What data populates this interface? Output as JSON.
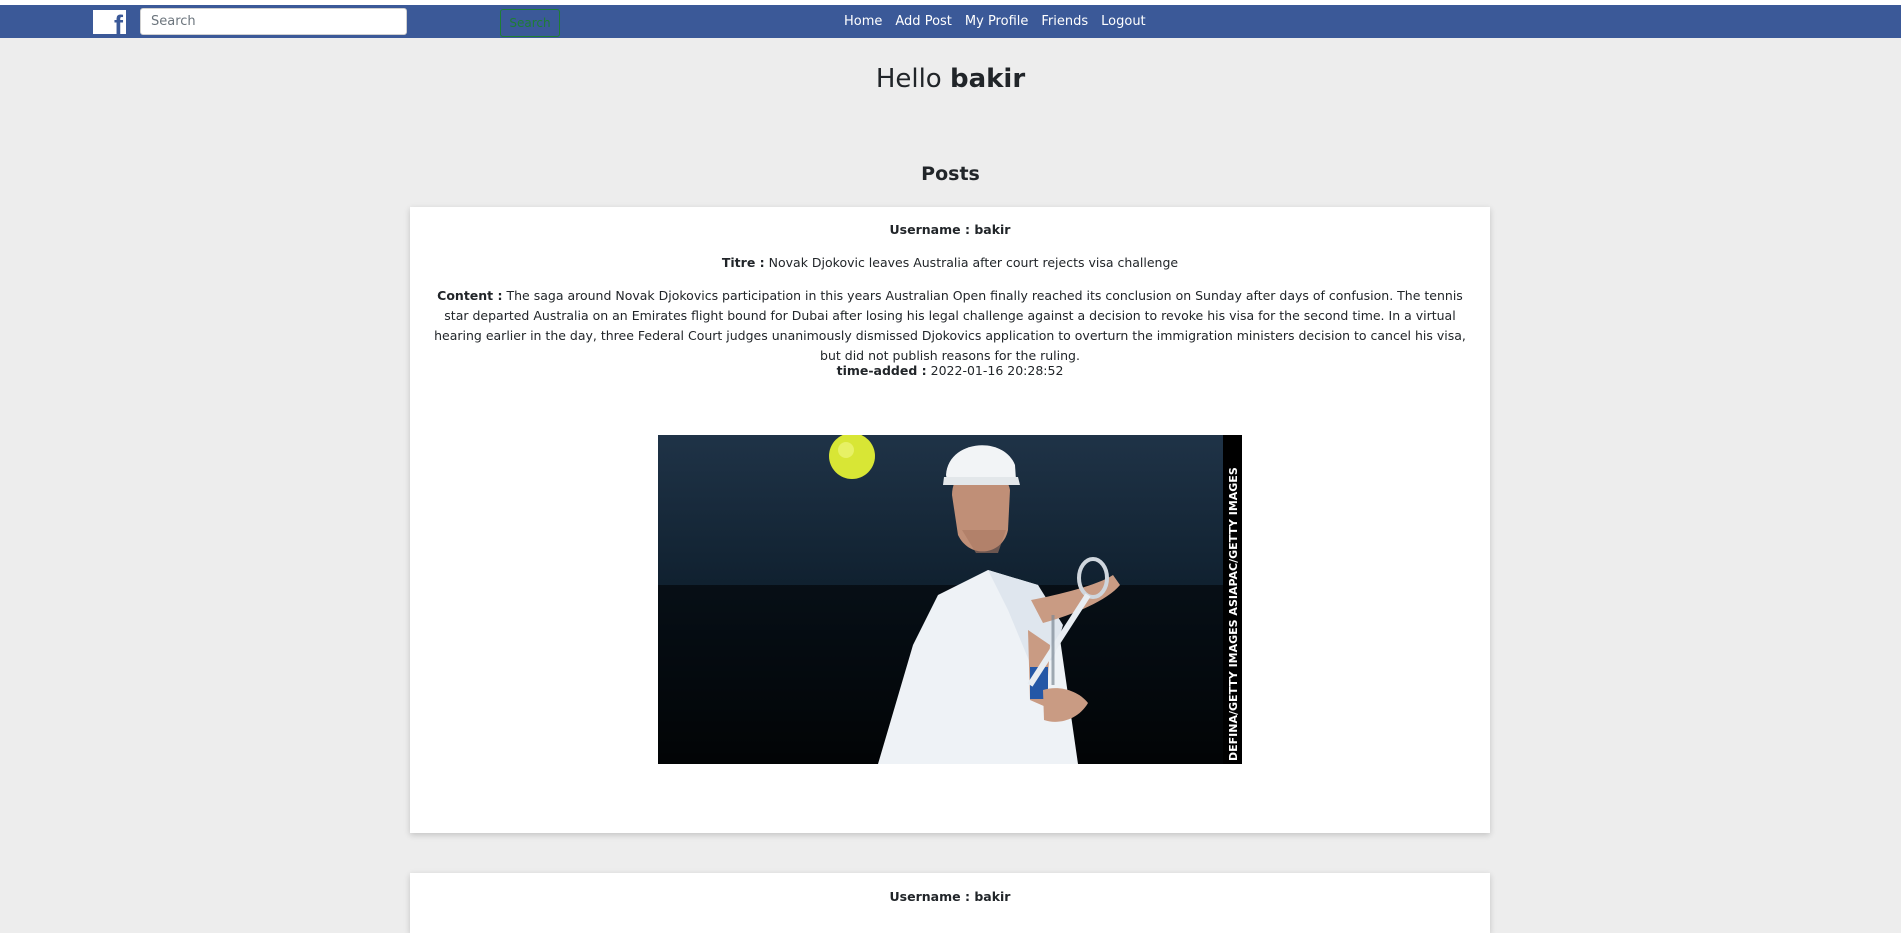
{
  "navbar": {
    "logo_icon": "facebook-f-icon",
    "search": {
      "placeholder": "Search",
      "value": ""
    },
    "search_button_label": "Search",
    "links": [
      "Home",
      "Add Post",
      "My Profile",
      "Friends",
      "Logout"
    ],
    "colors": {
      "bar": "#3b5998",
      "search_button": "#1e7e34"
    }
  },
  "greeting": {
    "prefix": "Hello",
    "username": "bakir"
  },
  "posts_heading": "Posts",
  "posts": [
    {
      "username_label": "Username :",
      "username": "bakir",
      "title_label": "Titre :",
      "title": "Novak Djokovic leaves Australia after court rejects visa challenge",
      "content_label": "Content :",
      "content": "The saga around Novak Djokovics participation in this years Australian Open finally reached its conclusion on Sunday after days of confusion. The tennis star departed Australia on an Emirates flight bound for Dubai after losing his legal challenge against a decision to revoke his visa for the second time. In a virtual hearing earlier in the day, three Federal Court judges unanimously dismissed Djokovics application to overturn the immigration ministers decision to cancel his visa, but did not publish reasons for the ruling.",
      "time_label": "time-added :",
      "time_added": "2022-01-16 20:28:52",
      "image_credit": "DEFINA/GETTY IMAGES ASIAPAC/GETTY IMAGES"
    },
    {
      "username_label": "Username :",
      "username": "bakir"
    }
  ]
}
